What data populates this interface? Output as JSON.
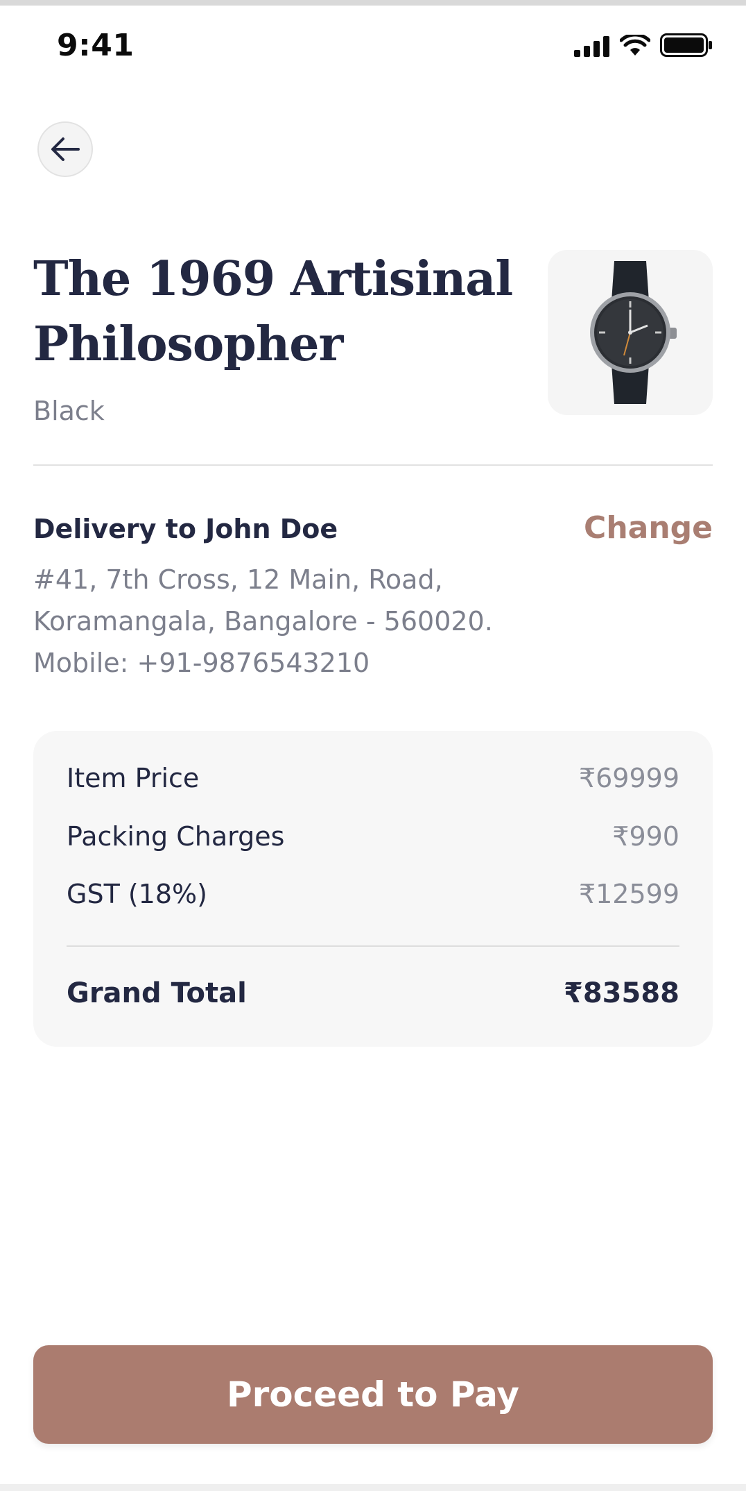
{
  "status_bar": {
    "time": "9:41",
    "icons": [
      "signal-icon",
      "wifi-icon",
      "battery-icon"
    ]
  },
  "header": {
    "back_icon": "arrow-left-icon"
  },
  "product": {
    "title": "The 1969 Artisinal Philosopher",
    "variant": "Black",
    "image": "watch-image"
  },
  "delivery": {
    "title": "Delivery to John Doe",
    "change_label": "Change",
    "address_line1": "#41, 7th Cross, 12 Main, Road,",
    "address_line2": "Koramangala, Bangalore - 560020.",
    "mobile": "Mobile: +91-9876543210"
  },
  "pricing": {
    "rows": [
      {
        "label": "Item Price",
        "value": "₹69999"
      },
      {
        "label": "Packing Charges",
        "value": "₹990"
      },
      {
        "label": "GST (18%)",
        "value": "₹12599"
      }
    ],
    "total_label": "Grand Total",
    "total_value": "₹83588"
  },
  "actions": {
    "pay_label": "Proceed to Pay"
  },
  "colors": {
    "accent": "#ab7c6f",
    "change_link": "#a97e72",
    "title_text": "#232842",
    "muted_text": "#7c7f8c",
    "card_bg": "#f7f7f7"
  }
}
